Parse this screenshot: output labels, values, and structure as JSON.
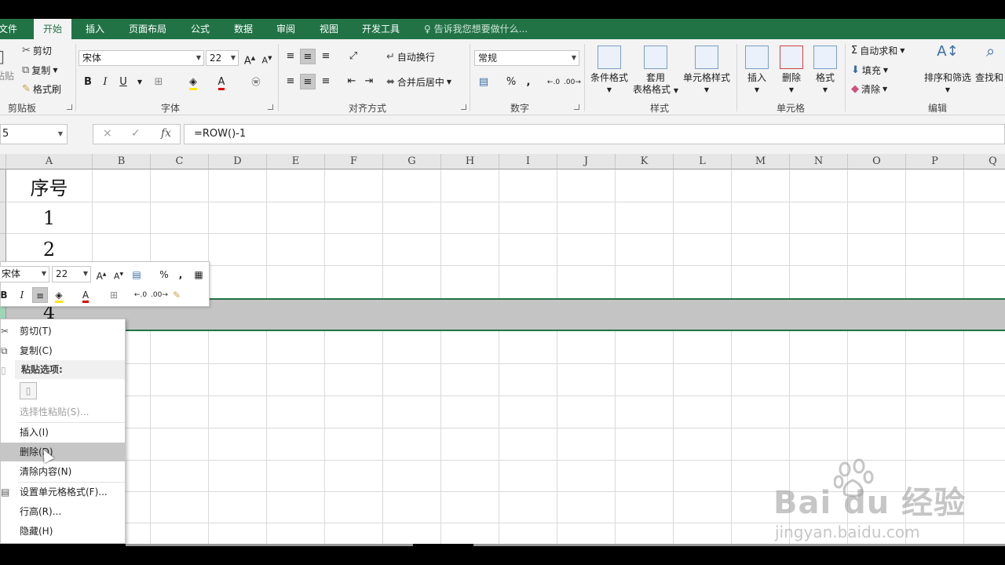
{
  "ribbon_tabs": [
    "文件",
    "开始",
    "插入",
    "页面布局",
    "公式",
    "数据",
    "审阅",
    "视图",
    "开发工具"
  ],
  "active_tab": "开始",
  "tell_me": "告诉我您想要做什么...",
  "clipboard": {
    "paste": "粘贴",
    "cut": "剪切",
    "copy": "复制",
    "format_painter": "格式刷",
    "group": "剪贴板"
  },
  "font": {
    "name": "宋体",
    "size": "22",
    "group": "字体",
    "bold": "B",
    "italic": "I",
    "underline": "U"
  },
  "alignment": {
    "wrap": "自动换行",
    "merge": "合并后居中",
    "group": "对齐方式"
  },
  "number": {
    "format": "常规",
    "group": "数字",
    "percent": "%",
    "comma": ","
  },
  "styles": {
    "conditional": "条件格式",
    "table_1": "套用",
    "table_2": "表格格式",
    "cell_styles": "单元格样式",
    "group": "样式"
  },
  "cells": {
    "insert": "插入",
    "delete": "删除",
    "format": "格式",
    "group": "单元格"
  },
  "editing": {
    "autosum": "自动求和",
    "fill": "填充",
    "clear": "清除",
    "sort": "排序和筛选",
    "find": "查找和",
    "group": "编辑"
  },
  "formula_bar": {
    "name_box": "5",
    "cancel": "×",
    "enter": "✓",
    "fx": "fx",
    "formula": "=ROW()-1"
  },
  "columns": [
    "A",
    "B",
    "C",
    "D",
    "E",
    "F",
    "G",
    "H",
    "I",
    "J",
    "K",
    "L",
    "M",
    "N",
    "O",
    "P",
    "Q"
  ],
  "cells_a": [
    "序号",
    "1",
    "2",
    "4"
  ],
  "mini_toolbar": {
    "font": "宋体",
    "size": "22",
    "bold": "B",
    "italic": "I",
    "percent": "%",
    "comma": ","
  },
  "context_menu": {
    "cut": "剪切(T)",
    "copy": "复制(C)",
    "paste_options": "粘贴选项:",
    "paste_special": "选择性粘贴(S)...",
    "insert": "插入(I)",
    "delete": "删除(D)",
    "clear": "清除内容(N)",
    "format_cells": "设置单元格格式(F)...",
    "row_height": "行高(R)...",
    "hide": "隐藏(H)"
  },
  "watermark": {
    "line1": "Bai du 经验",
    "line2": "jingyan.baidu.com"
  },
  "colors": {
    "excel_green": "#217346",
    "ribbon_bg": "#f3f3f3",
    "selection_gray": "#c4c4c4"
  }
}
